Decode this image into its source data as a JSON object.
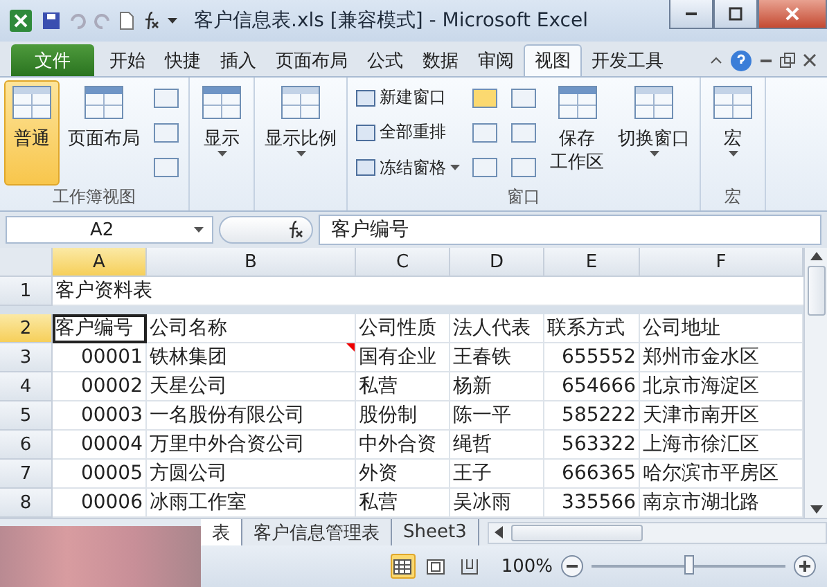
{
  "window": {
    "title": "客户信息表.xls  [兼容模式]  -  Microsoft Excel"
  },
  "ribbon_tabs": [
    {
      "label": "文件",
      "kind": "file",
      "selected": false
    },
    {
      "label": "开始",
      "kind": "tab",
      "selected": false
    },
    {
      "label": "快捷",
      "kind": "tab",
      "selected": false
    },
    {
      "label": "插入",
      "kind": "tab",
      "selected": false
    },
    {
      "label": "页面布局",
      "kind": "tab",
      "selected": false
    },
    {
      "label": "公式",
      "kind": "tab",
      "selected": false
    },
    {
      "label": "数据",
      "kind": "tab",
      "selected": false
    },
    {
      "label": "审阅",
      "kind": "tab",
      "selected": false
    },
    {
      "label": "视图",
      "kind": "tab",
      "selected": true
    },
    {
      "label": "开发工具",
      "kind": "tab",
      "selected": false
    }
  ],
  "ribbon_groups": [
    {
      "label": "工作簿视图",
      "large": [
        {
          "label": "普通",
          "kind": "single",
          "selected": true,
          "dropdown": false
        },
        {
          "label": "页面布局",
          "kind": "single",
          "selected": false,
          "dropdown": false
        }
      ]
    },
    {
      "large": [
        {
          "label": "显示",
          "kind": "single",
          "selected": false,
          "dropdown": true
        }
      ]
    },
    {
      "large": [
        {
          "label": "显示比例",
          "kind": "single",
          "selected": false,
          "dropdown": true
        }
      ]
    },
    {
      "label": "窗口",
      "small": [
        {
          "label": "新建窗口",
          "dropdown": false
        },
        {
          "label": "全部重排",
          "dropdown": false
        },
        {
          "label": "冻结窗格",
          "dropdown": true
        }
      ],
      "large": [
        {
          "label": "保存工作区",
          "kind": "two_line",
          "selected": false,
          "dropdown": false
        },
        {
          "label": "切换窗口",
          "kind": "single",
          "selected": false,
          "dropdown": true
        }
      ]
    },
    {
      "label": "宏",
      "large": [
        {
          "label": "宏",
          "kind": "single",
          "selected": false,
          "dropdown": true
        }
      ]
    }
  ],
  "formula_bar": {
    "name_box": "A2",
    "content": "客户编号"
  },
  "table": {
    "columns": [
      {
        "label": "A",
        "selected": true
      },
      {
        "label": "B",
        "selected": false
      },
      {
        "label": "C",
        "selected": false
      },
      {
        "label": "D",
        "selected": false
      },
      {
        "label": "E",
        "selected": false
      },
      {
        "label": "F",
        "selected": false
      }
    ],
    "rows": [
      {
        "number": "1",
        "kind": "title",
        "selected": false,
        "cells": [
          "客户资料表"
        ]
      },
      {
        "number": "2",
        "kind": "header",
        "selected": true,
        "cells": [
          "客户编号",
          "公司名称",
          "公司性质",
          "法人代表",
          "联系方式",
          "公司地址"
        ]
      },
      {
        "number": "3",
        "kind": "data",
        "selected": false,
        "cells": [
          "00001",
          {
            "text": "铁林集团",
            "comment": true
          },
          "国有企业",
          "王春铁",
          "655552",
          "郑州市金水区"
        ]
      },
      {
        "number": "4",
        "kind": "data",
        "selected": false,
        "cells": [
          "00002",
          "天星公司",
          "私营",
          "杨新",
          "654666",
          "北京市海淀区"
        ]
      },
      {
        "number": "5",
        "kind": "data",
        "selected": false,
        "cells": [
          "00003",
          "一名股份有限公司",
          "股份制",
          "陈一平",
          "585222",
          "天津市南开区"
        ]
      },
      {
        "number": "6",
        "kind": "data",
        "selected": false,
        "cells": [
          "00004",
          "万里中外合资公司",
          "中外合资",
          "绳哲",
          "563322",
          "上海市徐汇区"
        ]
      },
      {
        "number": "7",
        "kind": "data",
        "selected": false,
        "cells": [
          "00005",
          "方圆公司",
          "外资",
          "王子",
          "666365",
          "哈尔滨市平房区"
        ]
      },
      {
        "number": "8",
        "kind": "data",
        "selected": false,
        "cells": [
          "00006",
          "冰雨工作室",
          "私营",
          "吴冰雨",
          "335566",
          "南京市湖北路"
        ]
      }
    ]
  },
  "sheet_tabs": [
    {
      "label": "表",
      "selected": true
    },
    {
      "label": "客户信息管理表",
      "selected": false
    },
    {
      "label": "Sheet3",
      "selected": false
    }
  ],
  "status_bar": {
    "views": [
      {
        "kind": "normal",
        "selected": true
      },
      {
        "kind": "page_layout",
        "selected": false
      },
      {
        "kind": "page_break",
        "selected": false
      }
    ],
    "zoom": "100%",
    "zoom_slider": {
      "level": 0.5
    }
  }
}
